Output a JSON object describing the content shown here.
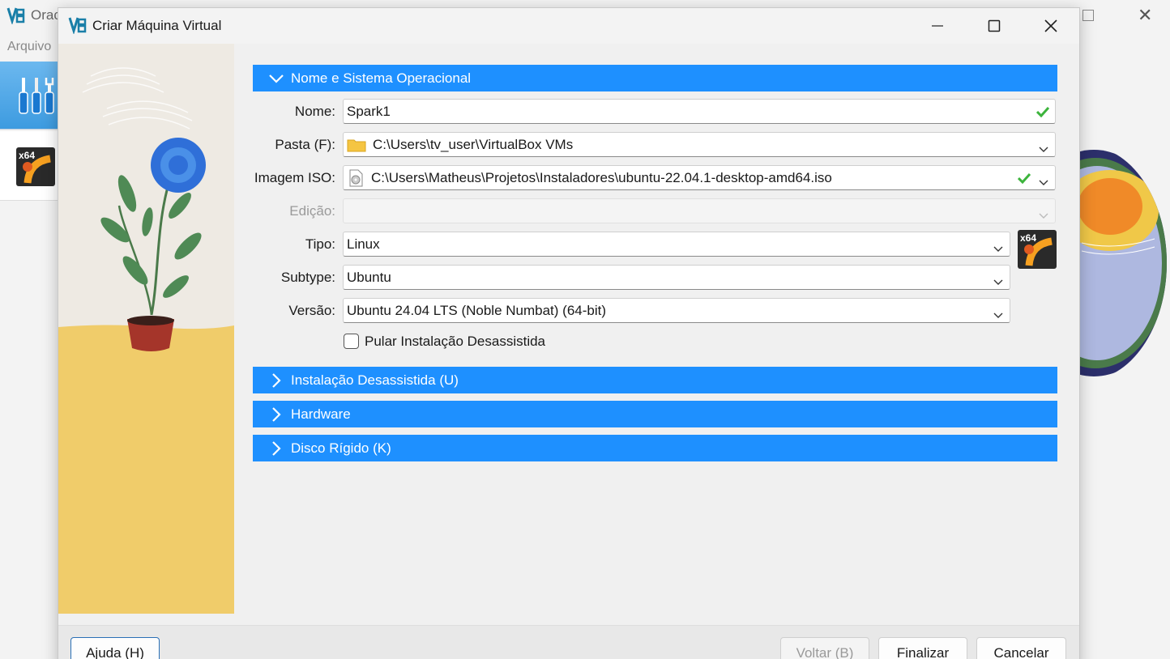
{
  "background": {
    "title": "Orac",
    "menu": "Arquivo"
  },
  "dialog": {
    "title": "Criar Máquina Virtual"
  },
  "sections": {
    "name_os": "Nome e Sistema Operacional",
    "unattended": "Instalação Desassistida (U)",
    "hardware": "Hardware",
    "disk": "Disco Rígido (K)"
  },
  "form": {
    "name_label": "Nome:",
    "name_value": "Spark1",
    "folder_label": "Pasta (F):",
    "folder_value": "C:\\Users\\tv_user\\VirtualBox VMs",
    "iso_label": "Imagem ISO:",
    "iso_value": "C:\\Users\\Matheus\\Projetos\\Instaladores\\ubuntu-22.04.1-desktop-amd64.iso",
    "edition_label": "Edição:",
    "edition_value": "",
    "type_label": "Tipo:",
    "type_value": "Linux",
    "subtype_label": "Subtype:",
    "subtype_value": "Ubuntu",
    "version_label": "Versão:",
    "version_value": "Ubuntu 24.04 LTS (Noble Numbat) (64-bit)",
    "skip_unattended_label": "Pular Instalação Desassistida",
    "skip_unattended_checked": false,
    "os_badge": "x64"
  },
  "buttons": {
    "help": "Ajuda (H)",
    "back": "Voltar (B)",
    "finish": "Finalizar",
    "cancel": "Cancelar"
  },
  "colors": {
    "accent": "#1e90ff",
    "check": "#3cb43c"
  },
  "icons": {
    "vbox": "virtualbox-logo-icon",
    "folder": "folder-icon",
    "disc": "optical-disc-icon",
    "check": "checkmark-icon",
    "dropdown": "chevron-down-icon"
  }
}
